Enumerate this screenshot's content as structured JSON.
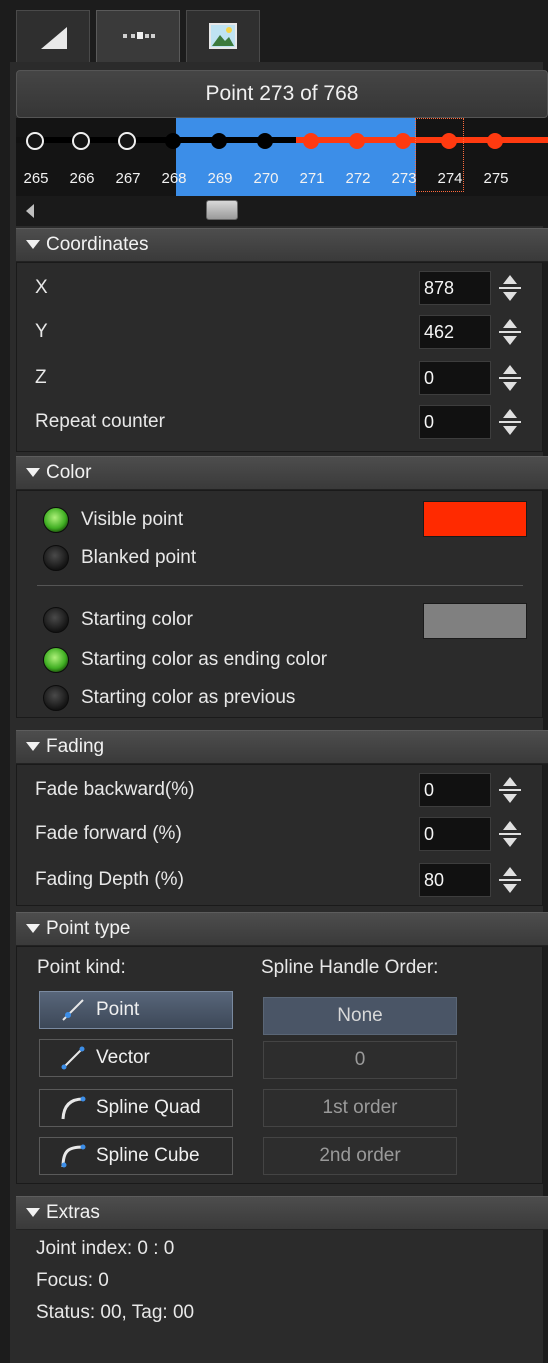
{
  "point_header": "Point 273 of 768",
  "timeline": {
    "labels": [
      "265",
      "266",
      "267",
      "268",
      "269",
      "270",
      "271",
      "272",
      "273",
      "274",
      "275"
    ]
  },
  "coordinates": {
    "header": "Coordinates",
    "x_label": "X",
    "x_value": "878",
    "y_label": "Y",
    "y_value": "462",
    "z_label": "Z",
    "z_value": "0",
    "repeat_label": "Repeat counter",
    "repeat_value": "0"
  },
  "color": {
    "header": "Color",
    "visible_point": "Visible point",
    "blanked_point": "Blanked point",
    "starting_color": "Starting color",
    "starting_as_ending": "Starting color as ending color",
    "starting_as_previous": "Starting color as previous",
    "visible_swatch": "#ff2a00",
    "starting_swatch": "#808080"
  },
  "fading": {
    "header": "Fading",
    "backward_label": "Fade backward(%)",
    "backward_value": "0",
    "forward_label": "Fade forward (%)",
    "forward_value": "0",
    "depth_label": "Fading Depth (%)",
    "depth_value": "80"
  },
  "point_type": {
    "header": "Point type",
    "kind_label": "Point kind:",
    "order_label": "Spline Handle Order:",
    "kinds": [
      "Point",
      "Vector",
      "Spline Quad",
      "Spline Cube"
    ],
    "orders": [
      "None",
      "0",
      "1st order",
      "2nd order"
    ]
  },
  "extras": {
    "header": "Extras",
    "joint": "Joint index: 0 : 0",
    "focus": "Focus: 0",
    "status": "Status: 00, Tag: 00"
  },
  "colors": {
    "accent": "#3c8ee8",
    "point_red": "#ff3a10",
    "active_radio": "#3fae22"
  }
}
